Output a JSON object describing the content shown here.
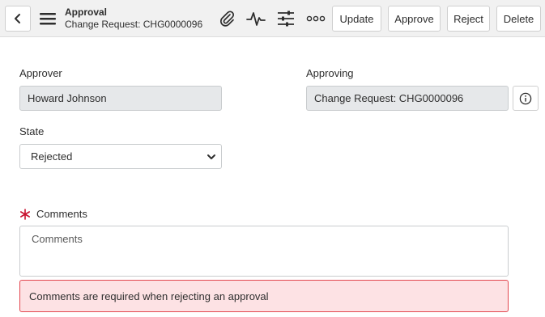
{
  "header": {
    "title": "Approval",
    "subtitle": "Change Request: CHG0000096",
    "icons": [
      "back-icon",
      "hamburger-menu-icon",
      "paperclip-icon",
      "activity-icon",
      "sliders-icon",
      "more-icon"
    ],
    "buttons": {
      "update": "Update",
      "approve": "Approve",
      "reject": "Reject",
      "delete": "Delete"
    }
  },
  "form": {
    "approver": {
      "label": "Approver",
      "value": "Howard Johnson"
    },
    "approving": {
      "label": "Approving",
      "value": "Change Request: CHG0000096"
    },
    "state": {
      "label": "State",
      "value": "Rejected"
    },
    "comments": {
      "label": "Comments",
      "placeholder": "Comments",
      "required": true,
      "error": "Comments are required when rejecting an approval"
    }
  },
  "colors": {
    "header_bg": "#f1f1f1",
    "readonly_bg": "#e6e8ea",
    "required_mark": "#c8102e",
    "error_bg": "#fde2e4",
    "error_border": "#e3474f"
  }
}
